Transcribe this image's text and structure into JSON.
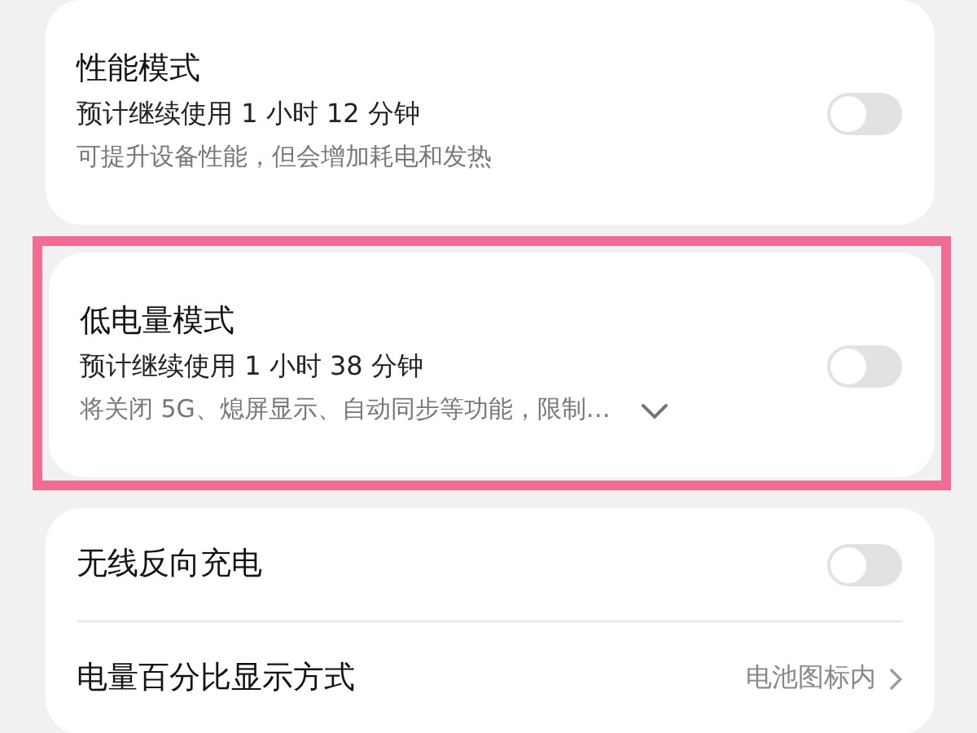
{
  "sections": [
    {
      "highlighted": false,
      "items": [
        {
          "kind": "toggle",
          "title": "性能模式",
          "subtitle": "预计继续使用 1 小时 12 分钟",
          "description": "可提升设备性能，但会增加耗电和发热",
          "on": false
        }
      ]
    },
    {
      "highlighted": true,
      "items": [
        {
          "kind": "toggle",
          "title": "低电量模式",
          "subtitle": "预计继续使用 1 小时 38 分钟",
          "description": "将关闭 5G、熄屏显示、自动同步等功能，限制…",
          "expanded": false,
          "on": false
        }
      ]
    },
    {
      "highlighted": false,
      "items": [
        {
          "kind": "toggle",
          "title": "无线反向充电",
          "on": false
        },
        {
          "kind": "link",
          "title": "电量百分比显示方式",
          "value": "电池图标内"
        }
      ]
    }
  ]
}
